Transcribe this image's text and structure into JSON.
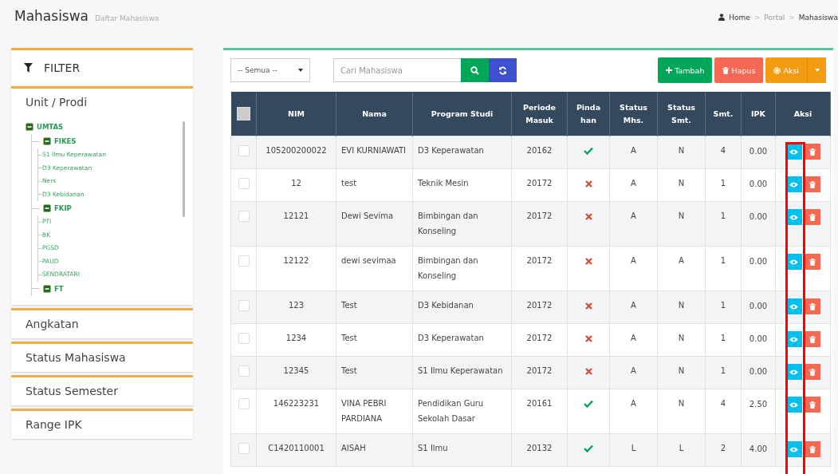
{
  "header": {
    "title": "Mahasiswa",
    "subtitle": "Daftar Mahasiswa",
    "breadcrumb": [
      "Home",
      "Portal",
      "Mahasiswa"
    ],
    "breadcrumb_separator": ">"
  },
  "filter": {
    "title": "FILTER",
    "sections": [
      {
        "label": "Unit / Prodi",
        "tree": [
          {
            "label": "UMTAS",
            "expanded": true,
            "children": [
              {
                "label": "FIKES",
                "expanded": true,
                "children": [
                  {
                    "label": "S1 Ilmu Keperawatan"
                  },
                  {
                    "label": "D3 Keperawatan"
                  },
                  {
                    "label": "Ners"
                  },
                  {
                    "label": "D3 Kebidanan"
                  }
                ]
              },
              {
                "label": "FKIP",
                "expanded": true,
                "children": [
                  {
                    "label": "PTI"
                  },
                  {
                    "label": "BK"
                  },
                  {
                    "label": "PGSD"
                  },
                  {
                    "label": "PAUD"
                  },
                  {
                    "label": "SENDRATARI"
                  }
                ]
              },
              {
                "label": "FT",
                "expanded": true
              }
            ]
          }
        ]
      },
      {
        "label": "Angkatan"
      },
      {
        "label": "Status Mahasiswa"
      },
      {
        "label": "Status Semester"
      },
      {
        "label": "Range IPK"
      }
    ]
  },
  "toolbar": {
    "select": "-- Semua --",
    "search_placeholder": "Cari Mahasiswa",
    "add": "Tambah",
    "delete": "Hapus",
    "actions": "Aksi"
  },
  "table": {
    "select_all_checked": false,
    "columns": [
      "NIM",
      "Nama",
      "Program Studi",
      "Periode Masuk",
      "Pinda han",
      "Status Mhs.",
      "Status Smt.",
      "Smt.",
      "IPK",
      "Aksi"
    ],
    "rows": [
      {
        "nim": "105200200022",
        "nama": "EVI KURNIAWATI",
        "prodi": "D3 Keperawatan",
        "periode": "20162",
        "transferred": true,
        "status_mhs": "A",
        "status_smt": "N",
        "smt": "4",
        "ipk": "0.00",
        "checked": false
      },
      {
        "nim": "12",
        "nama": "test",
        "prodi": "Teknik Mesin",
        "periode": "20172",
        "transferred": false,
        "status_mhs": "A",
        "status_smt": "N",
        "smt": "1",
        "ipk": "0.00",
        "checked": false
      },
      {
        "nim": "12121",
        "nama": "Dewi Sevima",
        "prodi": "Bimbingan dan Konseling",
        "periode": "20172",
        "transferred": false,
        "status_mhs": "A",
        "status_smt": "N",
        "smt": "1",
        "ipk": "0.00",
        "checked": false
      },
      {
        "nim": "12122",
        "nama": "dewi sevimaa",
        "prodi": "Bimbingan dan Konseling",
        "periode": "20172",
        "transferred": false,
        "status_mhs": "A",
        "status_smt": "A",
        "smt": "1",
        "ipk": "0.00",
        "checked": false
      },
      {
        "nim": "123",
        "nama": "Test",
        "prodi": "D3 Kebidanan",
        "periode": "20172",
        "transferred": false,
        "status_mhs": "A",
        "status_smt": "N",
        "smt": "1",
        "ipk": "0.00",
        "checked": false
      },
      {
        "nim": "1234",
        "nama": "Test",
        "prodi": "D3 Keperawatan",
        "periode": "20172",
        "transferred": false,
        "status_mhs": "A",
        "status_smt": "N",
        "smt": "1",
        "ipk": "0.00",
        "checked": false
      },
      {
        "nim": "12345",
        "nama": "Test",
        "prodi": "S1 Ilmu Keperawatan",
        "periode": "20172",
        "transferred": false,
        "status_mhs": "A",
        "status_smt": "N",
        "smt": "1",
        "ipk": "0.00",
        "checked": false
      },
      {
        "nim": "146223231",
        "nama": "VINA PEBRI PARDIANA",
        "prodi": "Pendidikan Guru Sekolah Dasar",
        "periode": "20161",
        "transferred": true,
        "status_mhs": "A",
        "status_smt": "N",
        "smt": "4",
        "ipk": "2.50",
        "checked": false
      },
      {
        "nim": "C1420110001",
        "nama": "AISAH",
        "prodi": "S1 Ilmu",
        "periode": "20132",
        "transferred": true,
        "status_mhs": "L",
        "status_smt": "L",
        "smt": "2",
        "ipk": "4.00",
        "checked": false
      }
    ]
  }
}
